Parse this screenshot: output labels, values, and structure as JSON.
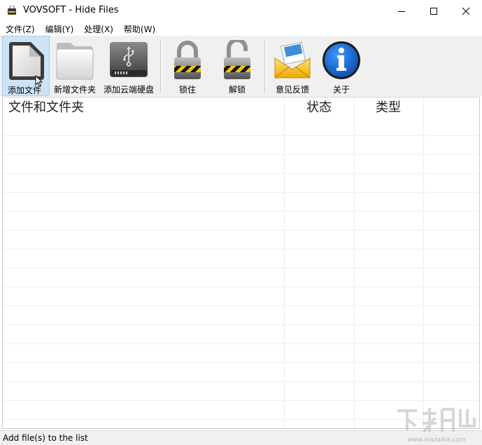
{
  "window": {
    "title": "VOVSOFT - Hide Files"
  },
  "menu": [
    {
      "label": "文件(Z)"
    },
    {
      "label": "编辑(Y)"
    },
    {
      "label": "处理(X)"
    },
    {
      "label": "帮助(W)"
    }
  ],
  "toolbar": {
    "add_file": "添加文件",
    "add_folder": "新增文件夹",
    "add_cloud_drive": "添加云端硬盘",
    "lock": "锁住",
    "unlock": "解锁",
    "feedback": "意见反馈",
    "about": "关于"
  },
  "list": {
    "columns": [
      {
        "label": "文件和文件夹"
      },
      {
        "label": "状态"
      },
      {
        "label": "类型"
      }
    ],
    "rows": []
  },
  "status": {
    "text": "Add file(s) to the list"
  },
  "watermark": {
    "text": "www.xiazaiba.com"
  },
  "colors": {
    "toolbar_bg": "#f0f0f0",
    "hover_bg": "#cde4f7",
    "about_blue": "#0d5fbf"
  }
}
